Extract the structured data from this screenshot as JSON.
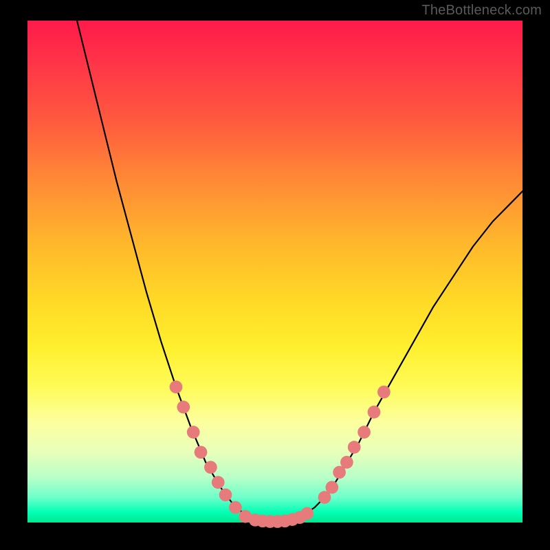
{
  "watermark": "TheBottleneck.com",
  "chart_data": {
    "type": "line",
    "title": "",
    "xlabel": "",
    "ylabel": "",
    "xlim": [
      0,
      100
    ],
    "ylim": [
      0,
      100
    ],
    "grid": false,
    "legend": false,
    "note": "Axes unlabeled in source image; values are pixel-space estimates on [0,100] domain.",
    "curve": [
      {
        "x": 10,
        "y": 100
      },
      {
        "x": 12,
        "y": 92
      },
      {
        "x": 15,
        "y": 80
      },
      {
        "x": 18,
        "y": 68
      },
      {
        "x": 21,
        "y": 57
      },
      {
        "x": 24,
        "y": 46
      },
      {
        "x": 27,
        "y": 36
      },
      {
        "x": 30,
        "y": 27
      },
      {
        "x": 33,
        "y": 19
      },
      {
        "x": 36,
        "y": 12
      },
      {
        "x": 39,
        "y": 7
      },
      {
        "x": 42,
        "y": 3
      },
      {
        "x": 45,
        "y": 1
      },
      {
        "x": 48,
        "y": 0.3
      },
      {
        "x": 50,
        "y": 0.2
      },
      {
        "x": 52,
        "y": 0.3
      },
      {
        "x": 55,
        "y": 1
      },
      {
        "x": 58,
        "y": 3
      },
      {
        "x": 61,
        "y": 6
      },
      {
        "x": 64,
        "y": 11
      },
      {
        "x": 67,
        "y": 16
      },
      {
        "x": 70,
        "y": 22
      },
      {
        "x": 74,
        "y": 29
      },
      {
        "x": 78,
        "y": 36
      },
      {
        "x": 82,
        "y": 43
      },
      {
        "x": 86,
        "y": 49
      },
      {
        "x": 90,
        "y": 55
      },
      {
        "x": 94,
        "y": 60
      },
      {
        "x": 98,
        "y": 64
      },
      {
        "x": 100,
        "y": 66
      }
    ],
    "markers": [
      {
        "x": 30,
        "y": 27
      },
      {
        "x": 31.5,
        "y": 23
      },
      {
        "x": 33.5,
        "y": 18
      },
      {
        "x": 35,
        "y": 14
      },
      {
        "x": 37,
        "y": 11
      },
      {
        "x": 38.5,
        "y": 8
      },
      {
        "x": 40,
        "y": 5.5
      },
      {
        "x": 42,
        "y": 3
      },
      {
        "x": 44,
        "y": 1.2
      },
      {
        "x": 46,
        "y": 0.5
      },
      {
        "x": 47.5,
        "y": 0.3
      },
      {
        "x": 49,
        "y": 0.2
      },
      {
        "x": 50.5,
        "y": 0.2
      },
      {
        "x": 52,
        "y": 0.3
      },
      {
        "x": 53.5,
        "y": 0.6
      },
      {
        "x": 55,
        "y": 1
      },
      {
        "x": 56.5,
        "y": 1.8
      },
      {
        "x": 60,
        "y": 5
      },
      {
        "x": 61.5,
        "y": 7
      },
      {
        "x": 63,
        "y": 10
      },
      {
        "x": 64.5,
        "y": 12
      },
      {
        "x": 66,
        "y": 15
      },
      {
        "x": 68,
        "y": 18
      },
      {
        "x": 70,
        "y": 22
      },
      {
        "x": 72,
        "y": 26
      }
    ],
    "marker_radius": 1.3,
    "colors": {
      "curve": "#000000",
      "marker": "#e77a7a",
      "gradient_top": "#ff1a4a",
      "gradient_bottom": "#00e890",
      "frame": "#000000"
    }
  }
}
